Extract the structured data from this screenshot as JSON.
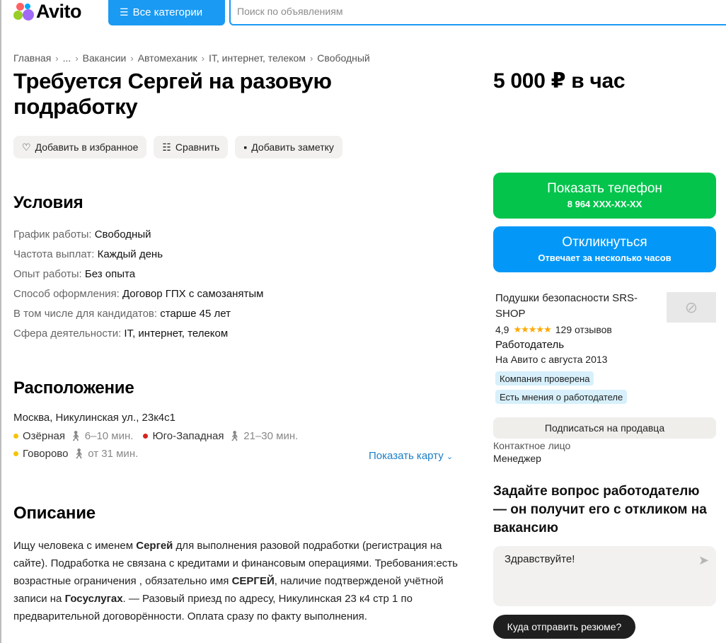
{
  "header": {
    "logo_text": "Avito",
    "categories_label": "Все категории",
    "search_placeholder": "Поиск по объявлениям"
  },
  "breadcrumbs": [
    "Главная",
    "...",
    "Вакансии",
    "Автомеханик",
    "IT, интернет, телеком",
    "Свободный"
  ],
  "title": "Требуется Сергей на разовую подработку",
  "price": "5 000 ₽ в час",
  "actions": {
    "favorite": "Добавить в избранное",
    "compare": "Сравнить",
    "note": "Добавить заметку"
  },
  "conditions": {
    "heading": "Условия",
    "items": [
      {
        "key": "График работы:",
        "value": "Свободный"
      },
      {
        "key": "Частота выплат:",
        "value": "Каждый день"
      },
      {
        "key": "Опыт работы:",
        "value": "Без опыта"
      },
      {
        "key": "Способ оформления:",
        "value": "Договор ГПХ с самозанятым"
      },
      {
        "key": "В том числе для кандидатов:",
        "value": "старше 45 лет"
      },
      {
        "key": "Сфера деятельности:",
        "value": "IT, интернет, телеком"
      }
    ]
  },
  "location": {
    "heading": "Расположение",
    "address": "Москва, Никулинская ул., 23к4с1",
    "metro": [
      {
        "name": "Озёрная",
        "time": "6–10 мин.",
        "color": "#f4c400"
      },
      {
        "name": "Юго-Западная",
        "time": "21–30 мин.",
        "color": "#d6251f"
      },
      {
        "name": "Говорово",
        "time": "от 31 мин.",
        "color": "#f4c400"
      }
    ],
    "show_map": "Показать карту"
  },
  "description": {
    "heading": "Описание",
    "p1": "Ищу человека с именем ",
    "b1": "Сергей",
    "p2": " для выполнения разовой подработки (регистрация на сайте). Подработка не связана с кредитами и финансовым операциями. Требования:есть возрастные ограничения , обязательно имя ",
    "b2": "СЕРГЕЙ",
    "p3": ", наличие подтвержденой учётной записи на ",
    "b3": "Госуслугах",
    "p4": ". — Разовый приезд по адресу, Никулинская 23 к4 стр 1 по предварительной договорённости. Оплата сразу по факту выполнения."
  },
  "sidebar": {
    "phone_label": "Показать телефон",
    "phone_number": "8 964 XXX-XX-XX",
    "respond_label": "Откликнуться",
    "respond_sub": "Отвечает за несколько часов",
    "seller_name": "Подушки безопасности SRS-SHOP",
    "rating": "4,9",
    "stars": "★★★★★",
    "reviews": "129 отзывов",
    "role": "Работодатель",
    "since": "На Авито с августа 2013",
    "badge_verified": "Компания проверена",
    "badge_opinions": "Есть мнения о работодателе",
    "subscribe": "Подписаться на продавца",
    "contact_label": "Контактное лицо",
    "contact_value": "Менеджер",
    "ask_heading": "Задайте вопрос работодателю — он получит его с откликом на вакансию",
    "message": "Здравствуйте!",
    "resume_button": "Куда отправить резюме?"
  },
  "colors": {
    "accent_blue": "#1a9af3",
    "green": "#04c44c",
    "blue": "#0398f7"
  }
}
